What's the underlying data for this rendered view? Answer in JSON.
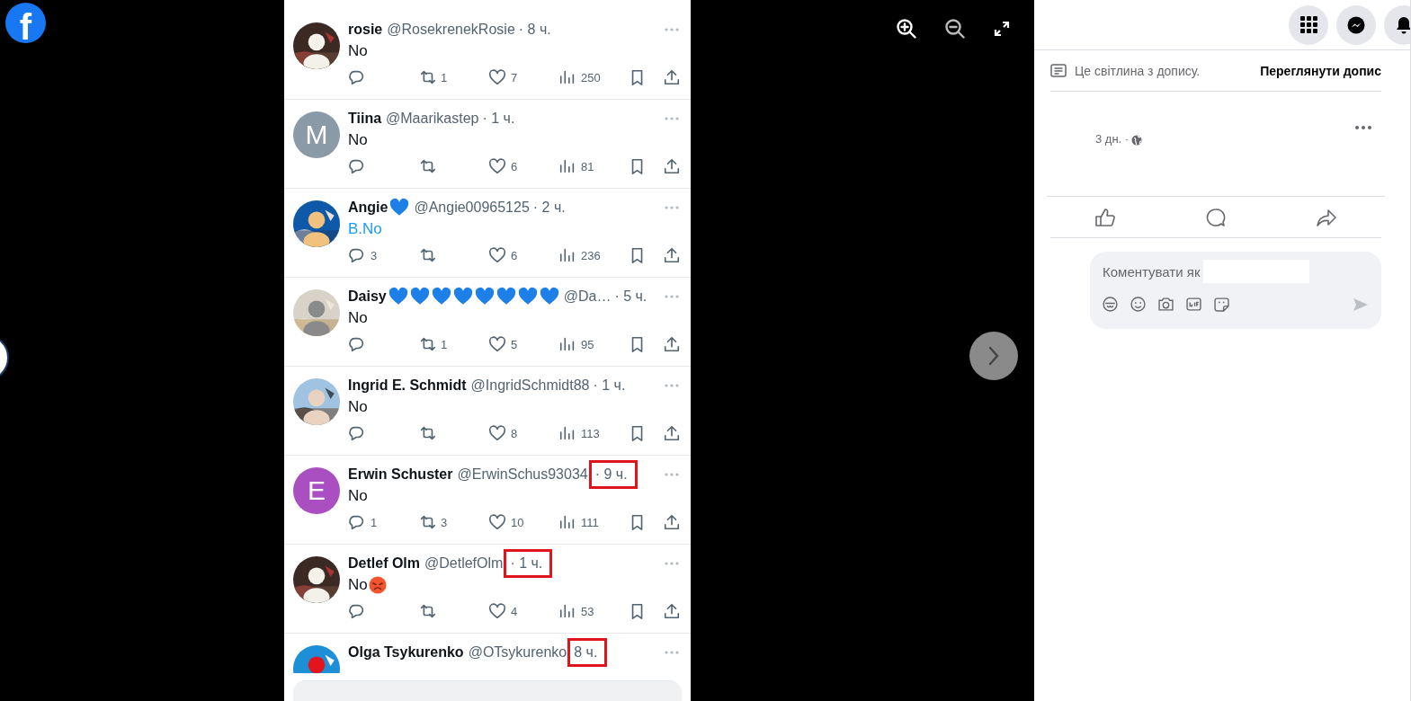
{
  "viewer": {
    "logo": "f"
  },
  "tweets": [
    {
      "name": "rosie",
      "handle": "@RosekrenekRosie",
      "time": "· 8 ч.",
      "highlighted": false,
      "body": "No",
      "body_link": false,
      "retweets": "1",
      "likes": "7",
      "views": "250"
    },
    {
      "name": "Tiina",
      "handle": "@Maarikastep",
      "time": "· 1 ч.",
      "highlighted": false,
      "avatar": {
        "kind": "letter",
        "letter": "M",
        "color": "#8a9aa6"
      },
      "body": "No",
      "body_link": false,
      "likes": "6",
      "views": "81"
    },
    {
      "name": "Angie",
      "name_emoji": [
        {
          "kind": "blue-heart"
        }
      ],
      "handle": "@Angie00965125",
      "time": "· 2 ч.",
      "highlighted": false,
      "body": "B.No",
      "body_link": true,
      "replies": "3",
      "likes": "6",
      "views": "236"
    },
    {
      "name": "Daisy",
      "name_emoji": [
        {
          "kind": "blue-heart"
        },
        {
          "kind": "blue-heart"
        },
        {
          "kind": "blue-heart"
        },
        {
          "kind": "blue-heart"
        },
        {
          "kind": "blue-heart"
        },
        {
          "kind": "blue-heart"
        },
        {
          "kind": "blue-heart"
        },
        {
          "kind": "blue-heart"
        }
      ],
      "handle": "@Da…",
      "time": "· 5 ч.",
      "highlighted": false,
      "body": "No",
      "body_link": false,
      "retweets": "1",
      "likes": "5",
      "views": "95"
    },
    {
      "name": "Ingrid E. Schmidt",
      "handle": "@IngridSchmidt88",
      "time": "· 1 ч.",
      "highlighted": false,
      "body": "No",
      "body_link": false,
      "likes": "8",
      "views": "113"
    },
    {
      "name": "Erwin Schuster",
      "handle": "@ErwinSchus93034",
      "time": "· 9 ч.",
      "highlighted": true,
      "avatar": {
        "kind": "letter",
        "letter": "E",
        "color": "#a94fc2"
      },
      "body": "No",
      "body_link": false,
      "replies": "1",
      "retweets": "3",
      "likes": "10",
      "views": "111"
    },
    {
      "name": "Detlef Olm",
      "handle": "@DetlefOlm",
      "time": "· 1 ч.",
      "highlighted": true,
      "body": "No",
      "body_emoji": [
        {
          "kind": "angry-face"
        }
      ],
      "body_link": false,
      "likes": "4",
      "views": "53"
    },
    {
      "name": "Olga Tsykurenko",
      "handle": "@OTsykurenko",
      "time": "8 ч.",
      "highlighted": true
    }
  ],
  "panel": {
    "notice": "Це світлина з допису.",
    "view_post": "Переглянути допис",
    "post_time": "3 дн. ·",
    "comment_placeholder": "Коментувати як"
  }
}
